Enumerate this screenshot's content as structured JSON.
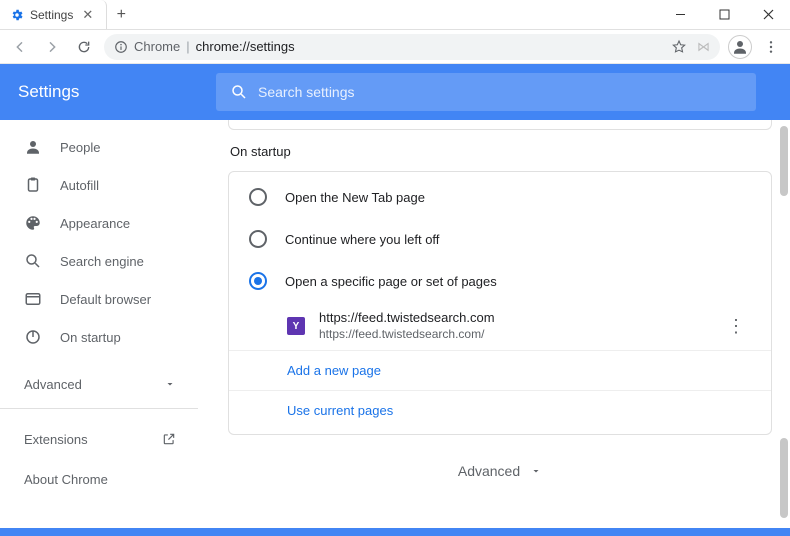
{
  "window": {
    "tab_title": "Settings",
    "address_host": "Chrome",
    "address_path": "chrome://settings"
  },
  "header": {
    "title": "Settings",
    "search_placeholder": "Search settings"
  },
  "sidebar": {
    "items": [
      {
        "label": "People"
      },
      {
        "label": "Autofill"
      },
      {
        "label": "Appearance"
      },
      {
        "label": "Search engine"
      },
      {
        "label": "Default browser"
      },
      {
        "label": "On startup"
      }
    ],
    "advanced": "Advanced",
    "extensions": "Extensions",
    "about": "About Chrome"
  },
  "main": {
    "section_title": "On startup",
    "options": [
      {
        "label": "Open the New Tab page"
      },
      {
        "label": "Continue where you left off"
      },
      {
        "label": "Open a specific page or set of pages"
      }
    ],
    "startup_page": {
      "title": "https://feed.twistedsearch.com",
      "url": "https://feed.twistedsearch.com/",
      "favicon_letter": "Y"
    },
    "add_page": "Add a new page",
    "use_current": "Use current pages",
    "advanced_footer": "Advanced"
  }
}
